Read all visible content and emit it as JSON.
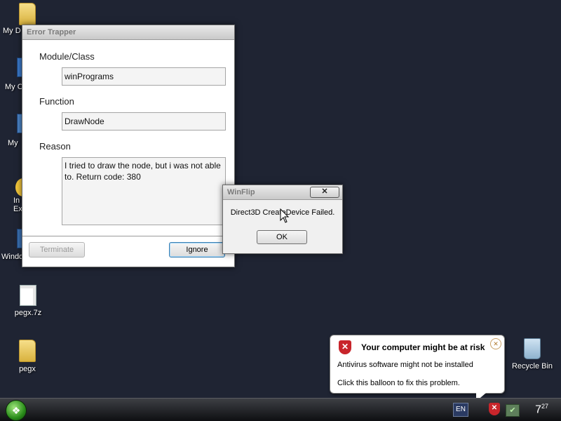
{
  "desktop": {
    "icons": [
      {
        "label": "pegx.7z",
        "icon": "archive-file-icon"
      },
      {
        "label": "pegx",
        "icon": "folder-icon"
      },
      {
        "label": "Recycle Bin",
        "icon": "recycle-bin-icon"
      }
    ],
    "partial_labels": [
      "My D",
      "My C",
      "My",
      "In",
      "Ex",
      "Windo"
    ]
  },
  "error_trapper": {
    "title": "Error Trapper",
    "module_label": "Module/Class",
    "module_value": "winPrograms",
    "function_label": "Function",
    "function_value": "DrawNode",
    "reason_label": "Reason",
    "reason_value": "I tried to draw the node, but i was not able to. Return code: 380",
    "terminate_label": "Terminate",
    "ignore_label": "Ignore"
  },
  "winflip": {
    "title": "WinFlip",
    "message": "Direct3D CreateDevice Failed.",
    "ok_label": "OK",
    "close_glyph": "✕"
  },
  "balloon": {
    "title": "Your computer might be at risk",
    "line1": "Antivirus software might not be installed",
    "line2": "Click this balloon to fix this problem.",
    "close_glyph": "✕"
  },
  "taskbar": {
    "language": "EN",
    "clock_hour": "7",
    "clock_min": "27"
  },
  "colors": {
    "desktop": "#1f2433",
    "security_red": "#c8252b"
  }
}
